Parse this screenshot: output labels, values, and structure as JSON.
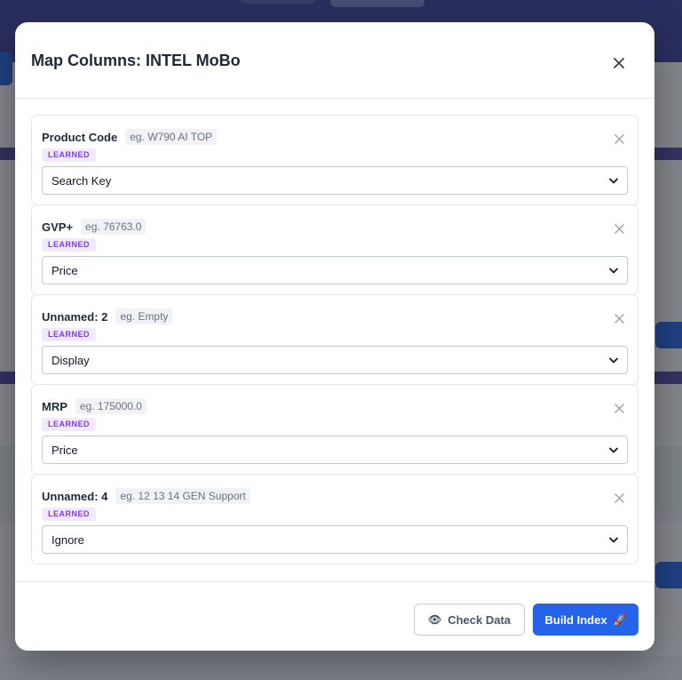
{
  "modal": {
    "title": "Map Columns: INTEL MoBo",
    "close_icon": "close-icon"
  },
  "columns": [
    {
      "name": "Product Code",
      "example": "eg. W790 AI TOP",
      "badge": "LEARNED",
      "mapping": "Search Key"
    },
    {
      "name": "GVP+",
      "example": "eg. 76763.0",
      "badge": "LEARNED",
      "mapping": "Price"
    },
    {
      "name": "Unnamed: 2",
      "example": "eg. Empty",
      "badge": "LEARNED",
      "mapping": "Display"
    },
    {
      "name": "MRP",
      "example": "eg. 175000.0",
      "badge": "LEARNED",
      "mapping": "Price"
    },
    {
      "name": "Unnamed: 4",
      "example": "eg. 12 13 14 GEN Support",
      "badge": "LEARNED",
      "mapping": "Ignore"
    }
  ],
  "footer": {
    "check_icon": "👁",
    "check_label": "Check Data",
    "build_label": "Build Index",
    "build_icon": "🚀"
  },
  "colors": {
    "primary": "#2563eb",
    "badge_text": "#7c3aed",
    "badge_bg": "#f1eafe"
  }
}
